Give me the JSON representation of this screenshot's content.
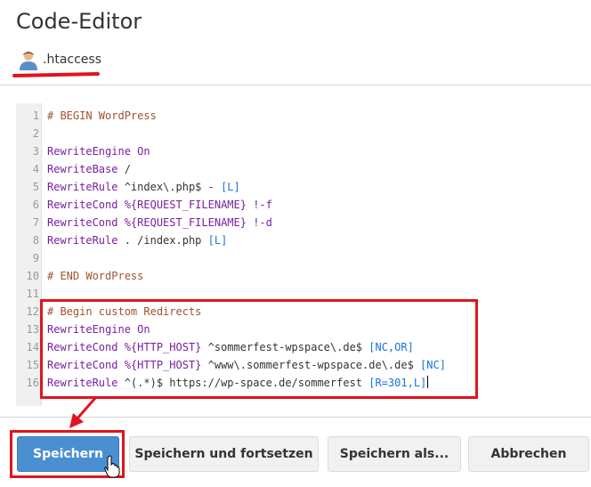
{
  "page": {
    "title": "Code-Editor"
  },
  "file": {
    "name": ".htaccess",
    "icon": "user-avatar-icon"
  },
  "editor": {
    "lines": [
      {
        "n": "1",
        "segments": [
          {
            "t": "# BEGIN WordPress",
            "c": "comment"
          }
        ]
      },
      {
        "n": "2",
        "segments": []
      },
      {
        "n": "3",
        "segments": [
          {
            "t": "RewriteEngine On",
            "c": "kw"
          }
        ]
      },
      {
        "n": "4",
        "segments": [
          {
            "t": "RewriteBase",
            "c": "kw"
          },
          {
            "t": " /",
            "c": "plain"
          }
        ]
      },
      {
        "n": "5",
        "segments": [
          {
            "t": "RewriteRule",
            "c": "kw"
          },
          {
            "t": " ^index\\.php$ - ",
            "c": "plain"
          },
          {
            "t": "[L]",
            "c": "flag"
          }
        ]
      },
      {
        "n": "6",
        "segments": [
          {
            "t": "RewriteCond",
            "c": "kw"
          },
          {
            "t": " %{REQUEST_FILENAME}",
            "c": "var"
          },
          {
            "t": " !-f",
            "c": "kw"
          }
        ]
      },
      {
        "n": "7",
        "segments": [
          {
            "t": "RewriteCond",
            "c": "kw"
          },
          {
            "t": " %{REQUEST_FILENAME}",
            "c": "var"
          },
          {
            "t": " !-d",
            "c": "kw"
          }
        ]
      },
      {
        "n": "8",
        "segments": [
          {
            "t": "RewriteRule",
            "c": "kw"
          },
          {
            "t": " . /index.php ",
            "c": "plain"
          },
          {
            "t": "[L]",
            "c": "flag"
          }
        ]
      },
      {
        "n": "9",
        "segments": []
      },
      {
        "n": "10",
        "segments": [
          {
            "t": "# END WordPress",
            "c": "comment"
          }
        ]
      },
      {
        "n": "11",
        "segments": []
      },
      {
        "n": "12",
        "segments": [
          {
            "t": "# Begin custom Redirects",
            "c": "comment"
          }
        ]
      },
      {
        "n": "13",
        "segments": [
          {
            "t": "RewriteEngine On",
            "c": "kw"
          }
        ]
      },
      {
        "n": "14",
        "segments": [
          {
            "t": "RewriteCond",
            "c": "kw"
          },
          {
            "t": " %{HTTP_HOST}",
            "c": "var"
          },
          {
            "t": " ^sommerfest-wpspace\\.de$ ",
            "c": "plain"
          },
          {
            "t": "[NC,OR]",
            "c": "flag"
          }
        ]
      },
      {
        "n": "15",
        "segments": [
          {
            "t": "RewriteCond",
            "c": "kw"
          },
          {
            "t": " %{HTTP_HOST}",
            "c": "var"
          },
          {
            "t": " ^www\\.sommerfest-wpspace.de\\.de$ ",
            "c": "plain"
          },
          {
            "t": "[NC]",
            "c": "flag"
          }
        ]
      },
      {
        "n": "16",
        "segments": [
          {
            "t": "RewriteRule",
            "c": "kw"
          },
          {
            "t": " ^(.*)$ https://wp-space.de/sommerfest ",
            "c": "plain"
          },
          {
            "t": "[R=301,L]",
            "c": "flag"
          }
        ],
        "cursor": true
      }
    ]
  },
  "buttons": {
    "save": "Speichern",
    "save_continue": "Speichern und fortsetzen",
    "save_as": "Speichern als...",
    "cancel": "Abbrechen"
  },
  "colors": {
    "accent": "#4c8fd1",
    "annotation": "#e0141e"
  }
}
